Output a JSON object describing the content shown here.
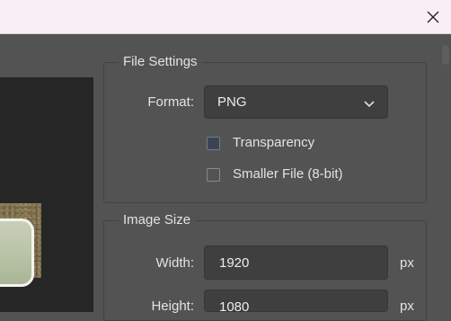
{
  "window": {
    "close_icon": "close-icon"
  },
  "file_settings": {
    "legend": "File Settings",
    "format_label": "Format:",
    "format_value": "PNG",
    "transparency_label": "Transparency",
    "transparency_checked": false,
    "smaller_file_label": "Smaller File (8-bit)",
    "smaller_file_checked": false
  },
  "image_size": {
    "legend": "Image Size",
    "width_label": "Width:",
    "width_value": "1920",
    "width_unit": "px",
    "height_label": "Height:",
    "height_value": "1080",
    "height_unit": "px"
  },
  "colors": {
    "panel_bg": "#535353",
    "field_bg": "#3f3f3f",
    "titlebar_bg": "#f9eef4"
  }
}
